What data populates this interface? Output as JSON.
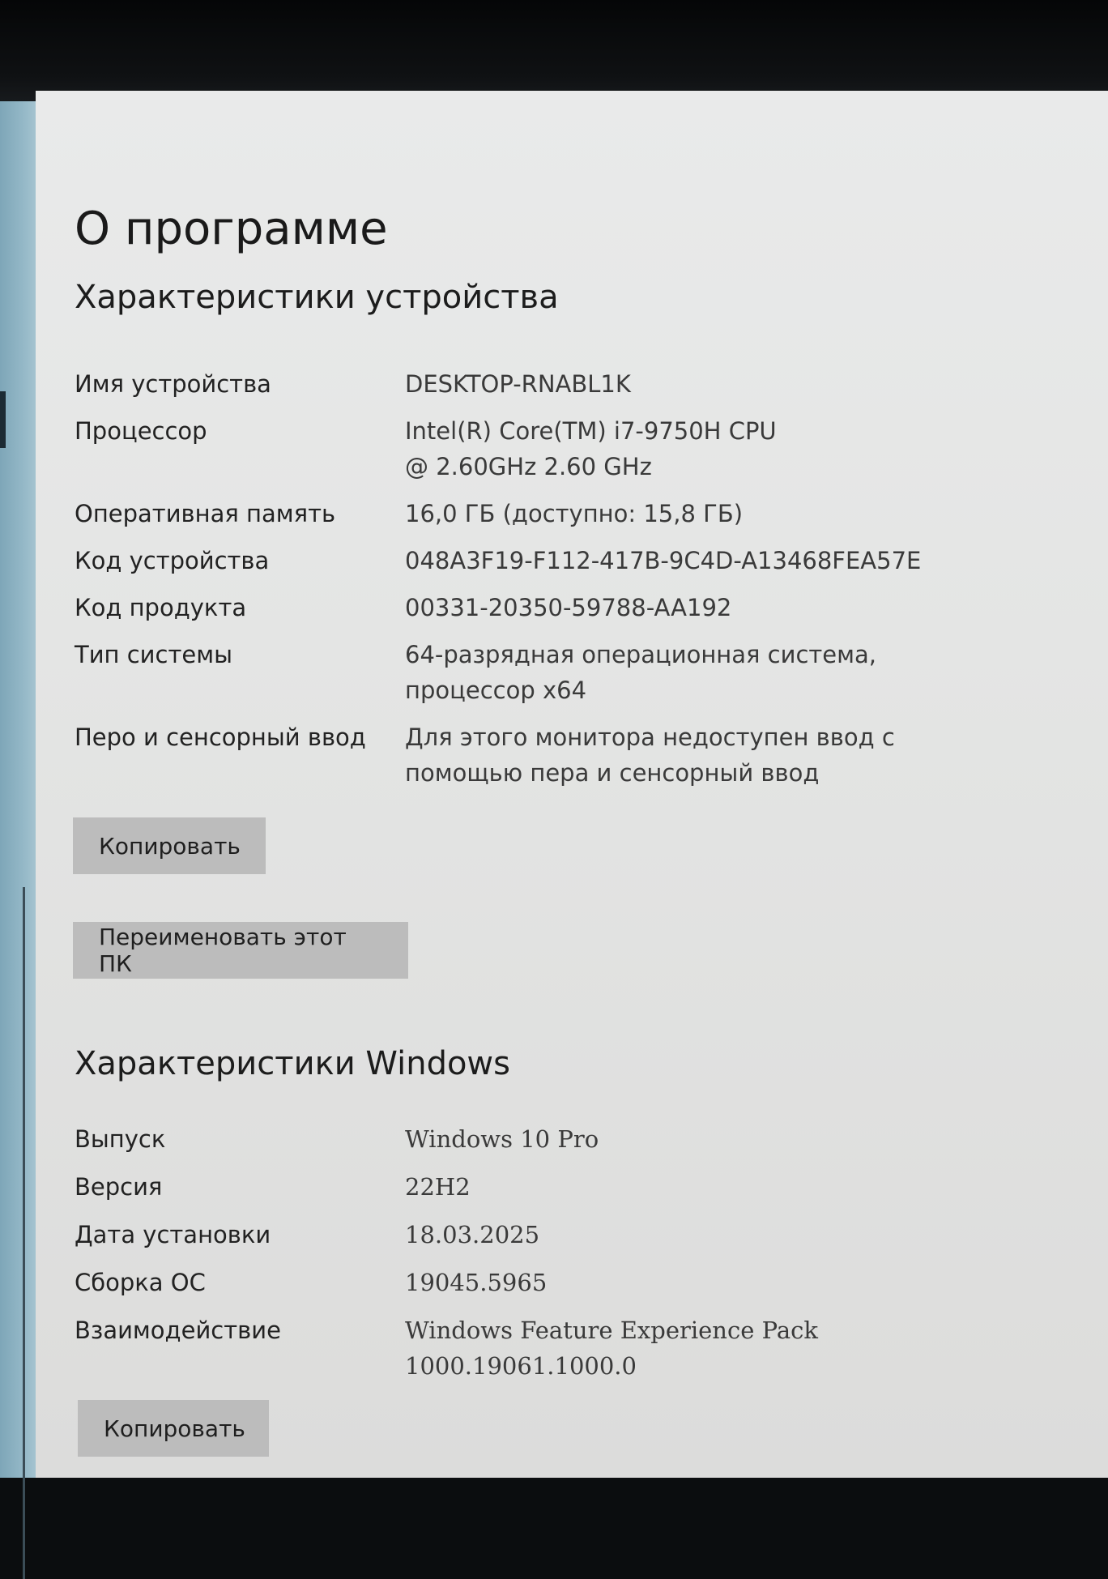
{
  "page": {
    "title": "О программе"
  },
  "device_specs": {
    "heading": "Характеристики устройства",
    "rows": [
      {
        "label": "Имя устройства",
        "value": "DESKTOP-RNABL1K"
      },
      {
        "label": "Процессор",
        "value": "Intel(R) Core(TM) i7-9750H CPU @ 2.60GHz 2.60 GHz"
      },
      {
        "label": "Оперативная память",
        "value": "16,0 ГБ (доступно: 15,8 ГБ)"
      },
      {
        "label": "Код устройства",
        "value": "048A3F19-F112-417B-9C4D-A13468FEA57E"
      },
      {
        "label": "Код продукта",
        "value": "00331-20350-59788-AA192"
      },
      {
        "label": "Тип системы",
        "value": "64-разрядная операционная система, процессор x64"
      },
      {
        "label": "Перо и сенсорный ввод",
        "value": "Для этого монитора недоступен ввод с помощью пера и сенсорный ввод"
      }
    ],
    "copy_button": "Копировать",
    "rename_button": "Переименовать этот ПК"
  },
  "windows_specs": {
    "heading": "Характеристики Windows",
    "rows": [
      {
        "label": "Выпуск",
        "value": "Windows 10 Pro"
      },
      {
        "label": "Версия",
        "value": "22H2"
      },
      {
        "label": "Дата установки",
        "value": "18.03.2025"
      },
      {
        "label": "Сборка ОС",
        "value": "19045.5965"
      },
      {
        "label": "Взаимодействие",
        "value": "Windows Feature Experience Pack 1000.19061.1000.0"
      }
    ],
    "copy_button": "Копировать"
  }
}
